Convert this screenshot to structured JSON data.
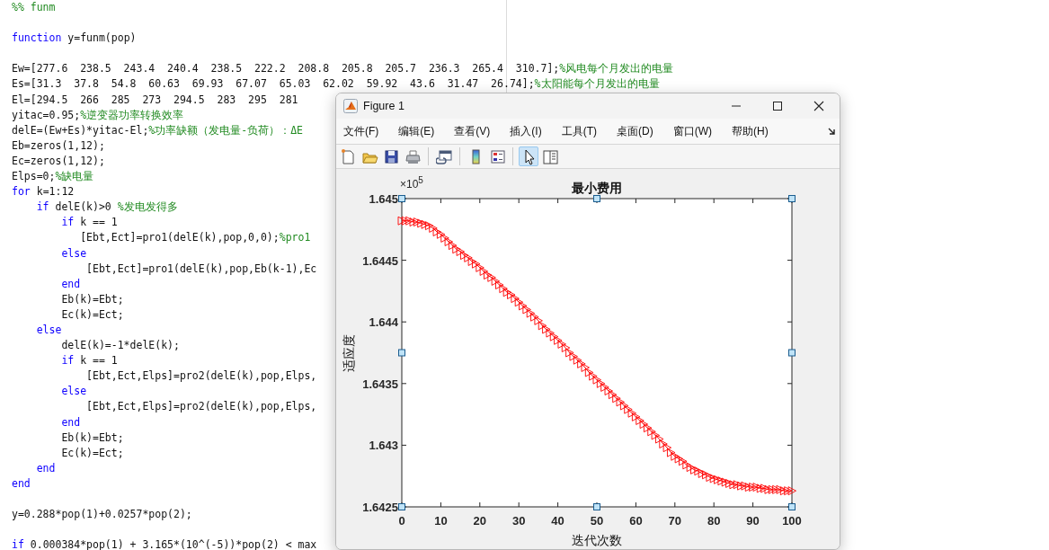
{
  "editor": {
    "blocks": [
      {
        "lines": [
          {
            "segments": [
              {
                "kind": "comment",
                "text": "%% funm"
              }
            ]
          }
        ]
      },
      {
        "lines": [
          {
            "segments": [
              {
                "kind": "keyword",
                "text": "function"
              },
              {
                "kind": "code",
                "text": " y=funm(pop)"
              }
            ]
          }
        ]
      },
      {
        "lines": [
          {
            "segments": [
              {
                "kind": "code",
                "text": "Ew=[277.6  238.5  243.4  240.4  238.5  222.2  208.8  205.8  205.7  236.3  265.4  310.7];"
              },
              {
                "kind": "comment",
                "text": "%风电每个月发出的电量"
              }
            ]
          },
          {
            "segments": [
              {
                "kind": "code",
                "text": "Es=[31.3  37.8  54.8  60.63  69.93  67.07  65.03  62.02  59.92  43.6  31.47  26.74];"
              },
              {
                "kind": "comment",
                "text": "%太阳能每个月发出的电量"
              }
            ]
          },
          {
            "segments": [
              {
                "kind": "code",
                "text": "El=[294.5  266  285  273  294.5  283  295  281"
              }
            ]
          },
          {
            "segments": [
              {
                "kind": "code",
                "text": "yitac=0.95;"
              },
              {
                "kind": "comment",
                "text": "%逆变器功率转换效率"
              }
            ]
          },
          {
            "segments": [
              {
                "kind": "code",
                "text": "delE=(Ew+Es)*yitac-El;"
              },
              {
                "kind": "comment",
                "text": "%功率缺额（发电量-负荷）：ΔE"
              }
            ]
          },
          {
            "segments": [
              {
                "kind": "code",
                "text": "Eb=zeros(1,12);"
              }
            ]
          },
          {
            "segments": [
              {
                "kind": "code",
                "text": "Ec=zeros(1,12);"
              }
            ]
          },
          {
            "segments": [
              {
                "kind": "code",
                "text": "Elps=0;"
              },
              {
                "kind": "comment",
                "text": "%缺电量"
              }
            ]
          },
          {
            "segments": [
              {
                "kind": "keyword",
                "text": "for"
              },
              {
                "kind": "code",
                "text": " k=1:12"
              }
            ]
          },
          {
            "segments": [
              {
                "kind": "keyword",
                "text": "    if"
              },
              {
                "kind": "code",
                "text": " delE(k)>0 "
              },
              {
                "kind": "comment",
                "text": "%发电发得多"
              }
            ]
          },
          {
            "segments": [
              {
                "kind": "keyword",
                "text": "        if"
              },
              {
                "kind": "code",
                "text": " k == 1"
              }
            ]
          },
          {
            "segments": [
              {
                "kind": "code",
                "text": "           [Ebt,Ect]=pro1(delE(k),pop,0,0);"
              },
              {
                "kind": "comment",
                "text": "%pro1"
              }
            ]
          },
          {
            "segments": [
              {
                "kind": "keyword",
                "text": "        else"
              }
            ]
          },
          {
            "segments": [
              {
                "kind": "code",
                "text": "            [Ebt,Ect]=pro1(delE(k),pop,Eb(k-1),Ec"
              }
            ]
          },
          {
            "segments": [
              {
                "kind": "keyword",
                "text": "        end"
              }
            ]
          },
          {
            "segments": [
              {
                "kind": "code",
                "text": "        Eb(k)=Ebt;"
              }
            ]
          },
          {
            "segments": [
              {
                "kind": "code",
                "text": "        Ec(k)=Ect;"
              }
            ]
          },
          {
            "segments": [
              {
                "kind": "keyword",
                "text": "    else"
              }
            ]
          },
          {
            "segments": [
              {
                "kind": "code",
                "text": "        delE(k)=-1*delE(k);"
              }
            ]
          },
          {
            "segments": [
              {
                "kind": "keyword",
                "text": "        if"
              },
              {
                "kind": "code",
                "text": " k == 1"
              }
            ]
          },
          {
            "segments": [
              {
                "kind": "code",
                "text": "            [Ebt,Ect,Elps]=pro2(delE(k),pop,Elps,"
              }
            ]
          },
          {
            "segments": [
              {
                "kind": "keyword",
                "text": "        else"
              }
            ]
          },
          {
            "segments": [
              {
                "kind": "code",
                "text": "            [Ebt,Ect,Elps]=pro2(delE(k),pop,Elps,"
              }
            ]
          },
          {
            "segments": [
              {
                "kind": "keyword",
                "text": "        end"
              }
            ]
          },
          {
            "segments": [
              {
                "kind": "code",
                "text": "        Eb(k)=Ebt;"
              }
            ]
          },
          {
            "segments": [
              {
                "kind": "code",
                "text": "        Ec(k)=Ect;"
              }
            ]
          },
          {
            "segments": [
              {
                "kind": "keyword",
                "text": "    end"
              }
            ]
          },
          {
            "segments": [
              {
                "kind": "keyword",
                "text": "end"
              }
            ]
          }
        ]
      },
      {
        "lines": [
          {
            "segments": [
              {
                "kind": "code",
                "text": "y=0.288*pop(1)+0.0257*pop(2);"
              }
            ]
          }
        ]
      },
      {
        "lines": [
          {
            "segments": [
              {
                "kind": "keyword",
                "text": "if"
              },
              {
                "kind": "code",
                "text": " 0.000384*pop(1) + 3.165*(10^(-5))*pop(2) < max"
              }
            ]
          }
        ]
      }
    ]
  },
  "figure_window": {
    "title": "Figure 1",
    "menu": [
      {
        "label": "文件(F)"
      },
      {
        "label": "编辑(E)"
      },
      {
        "label": "查看(V)"
      },
      {
        "label": "插入(I)"
      },
      {
        "label": "工具(T)"
      },
      {
        "label": "桌面(D)"
      },
      {
        "label": "窗口(W)"
      },
      {
        "label": "帮助(H)"
      }
    ],
    "toolbar": [
      {
        "items": [
          {
            "kind": "new",
            "selected": false
          },
          {
            "kind": "open",
            "selected": false
          },
          {
            "kind": "save",
            "selected": false
          },
          {
            "kind": "print",
            "selected": false
          }
        ]
      },
      {
        "items": [
          {
            "kind": "link",
            "selected": false
          }
        ]
      },
      {
        "items": [
          {
            "kind": "colorbar",
            "selected": false
          },
          {
            "kind": "legend",
            "selected": false
          }
        ]
      },
      {
        "items": [
          {
            "kind": "pointer",
            "selected": true
          },
          {
            "kind": "inspector",
            "selected": false
          }
        ]
      }
    ],
    "axes": {
      "selected": true,
      "chart_data": {
        "type": "line",
        "title": "最小费用",
        "xlabel": "迭代次数",
        "ylabel": "适应度",
        "x": [
          0,
          1,
          2,
          3,
          4,
          5,
          6,
          7,
          8,
          9,
          10,
          11,
          12,
          13,
          14,
          15,
          16,
          17,
          18,
          19,
          20,
          21,
          22,
          23,
          24,
          25,
          26,
          27,
          28,
          29,
          30,
          31,
          32,
          33,
          34,
          35,
          36,
          37,
          38,
          39,
          40,
          41,
          42,
          43,
          44,
          45,
          46,
          47,
          48,
          49,
          50,
          51,
          52,
          53,
          54,
          55,
          56,
          57,
          58,
          59,
          60,
          61,
          62,
          63,
          64,
          65,
          66,
          67,
          68,
          69,
          70,
          71,
          72,
          73,
          74,
          75,
          76,
          77,
          78,
          79,
          80,
          81,
          82,
          83,
          84,
          85,
          86,
          87,
          88,
          89,
          90,
          91,
          92,
          93,
          94,
          95,
          96,
          97,
          98,
          99,
          100
        ],
        "series": [
          {
            "color": "#ff0000",
            "marker": "triangle-right",
            "values": [
              1.64482,
              1.64482,
              1.64482,
              1.64481,
              1.64481,
              1.6448,
              1.64479,
              1.64478,
              1.64476,
              1.64473,
              1.64471,
              1.64468,
              1.64465,
              1.64462,
              1.64459,
              1.64457,
              1.64454,
              1.64452,
              1.64449,
              1.64447,
              1.64444,
              1.64441,
              1.64438,
              1.64436,
              1.64433,
              1.6443,
              1.64427,
              1.64424,
              1.64422,
              1.64419,
              1.64416,
              1.64413,
              1.6441,
              1.64407,
              1.64404,
              1.64401,
              1.64397,
              1.64394,
              1.64391,
              1.64388,
              1.64385,
              1.64382,
              1.64379,
              1.64375,
              1.64372,
              1.64369,
              1.64366,
              1.64363,
              1.64359,
              1.64356,
              1.64353,
              1.6435,
              1.64347,
              1.64344,
              1.64341,
              1.64338,
              1.64335,
              1.64332,
              1.64329,
              1.64326,
              1.64323,
              1.6432,
              1.64317,
              1.64314,
              1.64311,
              1.64308,
              1.64305,
              1.64301,
              1.64298,
              1.64294,
              1.64291,
              1.64289,
              1.64287,
              1.64284,
              1.64282,
              1.6428,
              1.64279,
              1.64277,
              1.64276,
              1.64274,
              1.64273,
              1.64272,
              1.64271,
              1.6427,
              1.64269,
              1.64268,
              1.64268,
              1.64267,
              1.64267,
              1.64266,
              1.64266,
              1.64266,
              1.64265,
              1.64265,
              1.64264,
              1.64264,
              1.64264,
              1.64264,
              1.64263,
              1.64263,
              1.64263
            ]
          }
        ],
        "xlim": [
          0,
          100
        ],
        "ylim": [
          1.6425,
          1.645
        ],
        "xticks": [
          0,
          10,
          20,
          30,
          40,
          50,
          60,
          70,
          80,
          90,
          100
        ],
        "yticks": [
          1.6425,
          1.643,
          1.6435,
          1.644,
          1.6445,
          1.645
        ],
        "annotations": [
          {
            "text": "×10$^{5}$"
          }
        ]
      }
    }
  }
}
